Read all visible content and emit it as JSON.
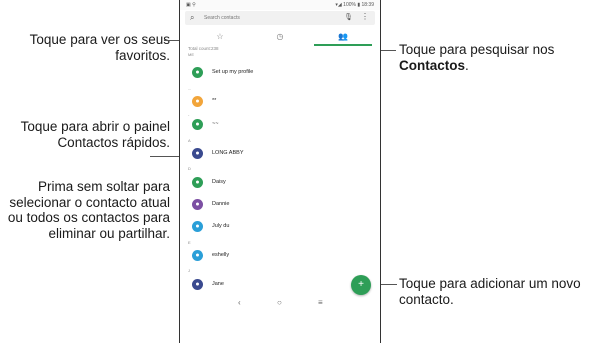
{
  "callouts": {
    "favorites": "Toque para ver os seus favoritos.",
    "search_line1": "Toque para pesquisar nos",
    "search_line2": "Contactos",
    "search_line2_end": ".",
    "quick1": "Toque para abrir o painel Contactos rápidos.",
    "quick2": "Prima sem soltar para selecionar o contacto atual ou todos os contactos para eliminar ou partilhar.",
    "add": "Toque para adicionar um novo contacto."
  },
  "statusbar": {
    "left": "▣ ⚲",
    "right": "▾◢ 100% ▮ 18:39"
  },
  "search": {
    "placeholder": "Search contacts"
  },
  "tabs": {
    "favorites_icon": "☆",
    "recent_icon": "◷",
    "contacts_icon": "👥"
  },
  "total": "Total count:238",
  "sections": {
    "me": "ME",
    "a": "A",
    "d": "D",
    "j": "J",
    "e": "E",
    "dots": "...",
    "dash": "-"
  },
  "contacts": [
    {
      "name": "Set up my profile",
      "color": "#2e9e57",
      "icon": "person-icon"
    },
    {
      "name": "**",
      "color": "#f2a53a",
      "icon": "person-icon"
    },
    {
      "name": "~~",
      "color": "#2e9e57",
      "icon": "person-icon"
    },
    {
      "name": "LONG ABBY",
      "color": "#3a4a8f",
      "icon": "person-icon"
    },
    {
      "name": "Daisy",
      "color": "#2e9e57",
      "icon": "person-icon"
    },
    {
      "name": "Dannie",
      "color": "#7c4fa3",
      "icon": "person-icon"
    },
    {
      "name": "July du",
      "color": "#2a9fd8",
      "icon": "person-icon"
    },
    {
      "name": "eshelly",
      "color": "#2a9fd8",
      "icon": "person-icon"
    },
    {
      "name": "Jane",
      "color": "#3a4a8f",
      "icon": "person-icon"
    }
  ],
  "navbar": {
    "back": "‹",
    "home": "○",
    "recents": "≡"
  }
}
